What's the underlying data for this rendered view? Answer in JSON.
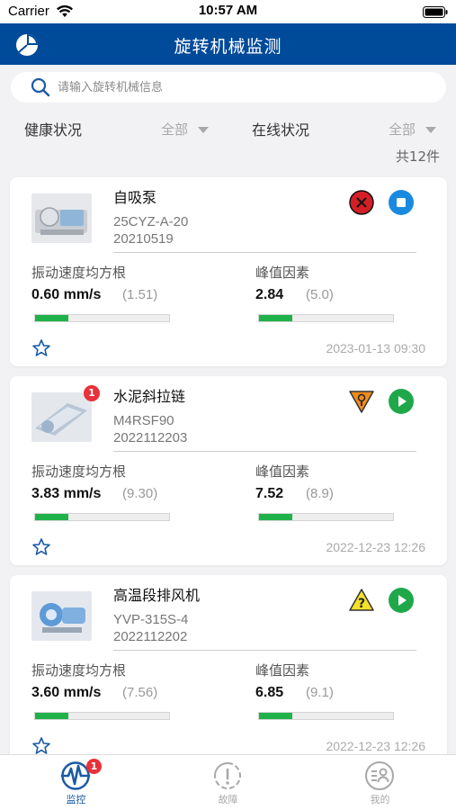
{
  "status_bar": {
    "carrier": "Carrier",
    "time": "10:57 AM"
  },
  "header": {
    "title": "旋转机械监测"
  },
  "search": {
    "placeholder": "请输入旋转机械信息",
    "value": ""
  },
  "filters": {
    "health": {
      "label": "健康状况",
      "value": "全部"
    },
    "online": {
      "label": "在线状况",
      "value": "全部"
    },
    "total": "共12件"
  },
  "machines": [
    {
      "name": "自吸泵",
      "model": "25CYZ-A-20",
      "serial": "20210519",
      "badge": "",
      "health_icon": "fault-x-icon",
      "run_icon": "stop-icon",
      "vib_label": "振动速度均方根",
      "vib_value": "0.60 mm/s",
      "vib_ref": "(1.51)",
      "vib_level": 0.25,
      "peak_label": "峰值因素",
      "peak_value": "2.84",
      "peak_ref": "(5.0)",
      "peak_level": 0.25,
      "timestamp": "2023-01-13 09:30"
    },
    {
      "name": "水泥斜拉链",
      "model": "M4RSF90",
      "serial": "2022112203",
      "badge": "1",
      "health_icon": "alarm-triangle-icon",
      "run_icon": "play-icon",
      "vib_label": "振动速度均方根",
      "vib_value": "3.83 mm/s",
      "vib_ref": "(9.30)",
      "vib_level": 0.25,
      "peak_label": "峰值因素",
      "peak_value": "7.52",
      "peak_ref": "(8.9)",
      "peak_level": 0.25,
      "timestamp": "2022-12-23 12:26"
    },
    {
      "name": "高温段排风机",
      "model": "YVP-315S-4",
      "serial": "2022112202",
      "badge": "",
      "health_icon": "warning-triangle-icon",
      "run_icon": "play-icon",
      "vib_label": "振动速度均方根",
      "vib_value": "3.60 mm/s",
      "vib_ref": "(7.56)",
      "vib_level": 0.25,
      "peak_label": "峰值因素",
      "peak_value": "6.85",
      "peak_ref": "(9.1)",
      "peak_level": 0.25,
      "timestamp": "2022-12-23 12:26"
    }
  ],
  "tabs": [
    {
      "label": "监控",
      "icon": "pulse-icon",
      "badge": "1",
      "active": true
    },
    {
      "label": "故障",
      "icon": "fault-alert-icon",
      "badge": "",
      "active": false
    },
    {
      "label": "我的",
      "icon": "profile-icon",
      "badge": "",
      "active": false
    }
  ],
  "colors": {
    "header_bg": "#004a9a",
    "progress": "#1fb24a",
    "fault_red": "#d41f26",
    "stop_blue": "#1a8ae0",
    "run_green": "#1fa84a",
    "warning_yellow": "#f4e12a",
    "alarm_orange": "#f08c1c",
    "tab_active": "#1a5aa6",
    "badge_red": "#e8313a"
  }
}
